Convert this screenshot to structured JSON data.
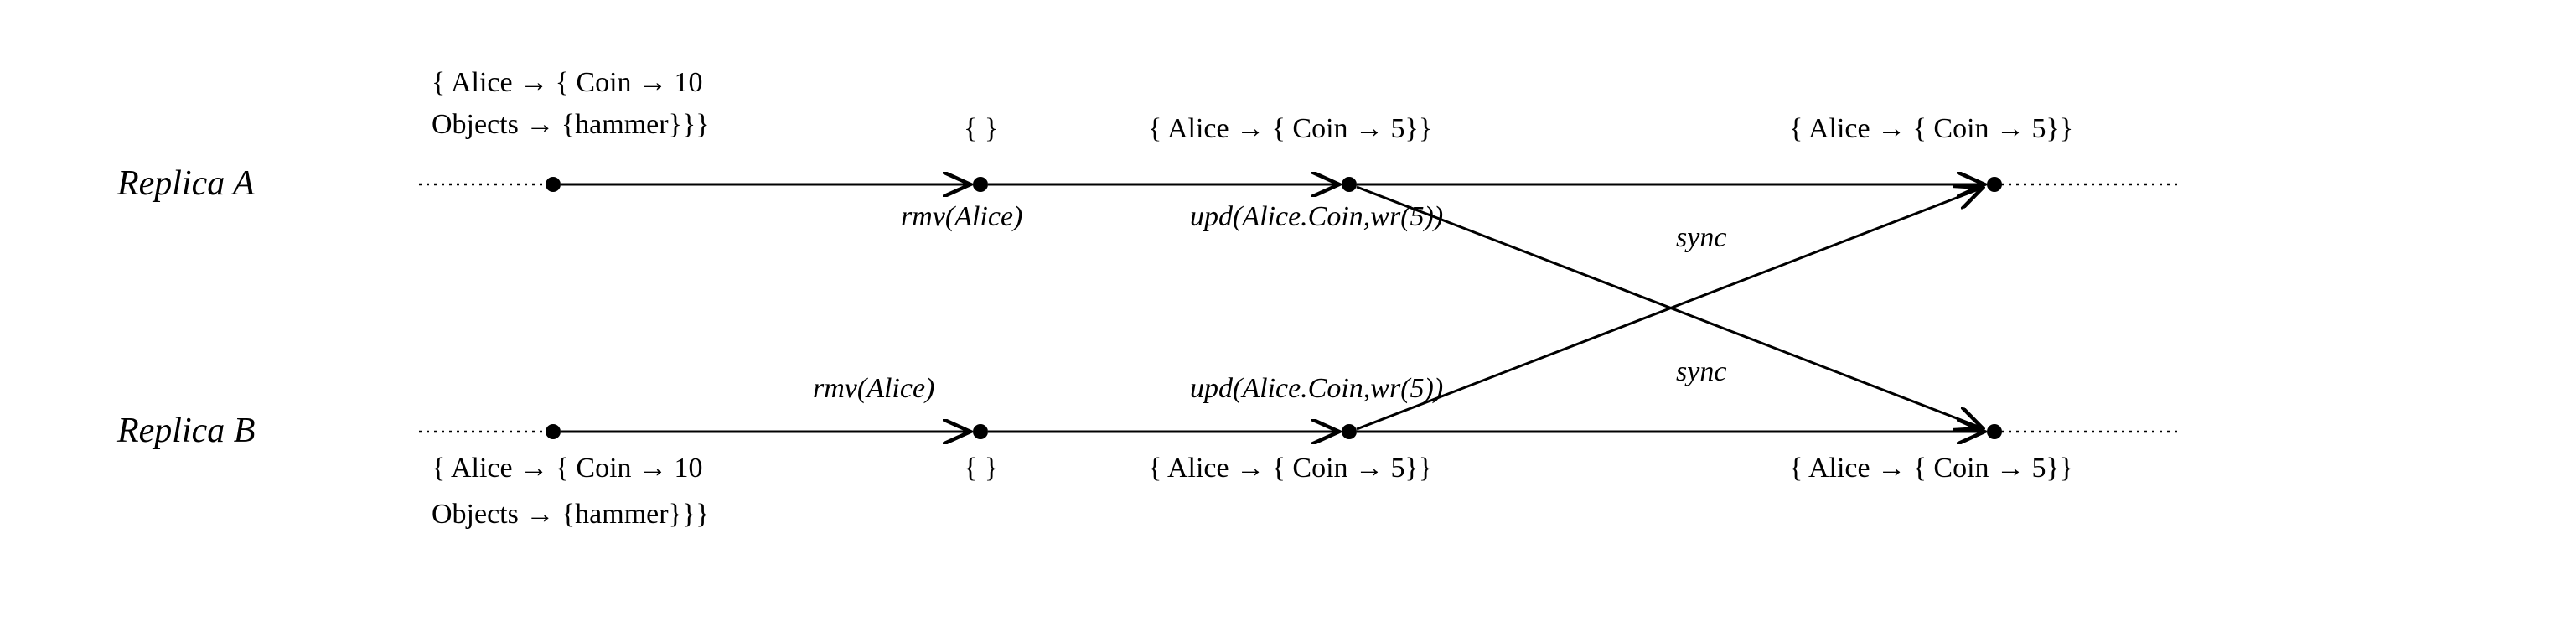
{
  "replicas": {
    "A": {
      "label": "Replica A"
    },
    "B": {
      "label": "Replica B"
    }
  },
  "states": {
    "a0_line1": "{ Alice → { Coin → 10",
    "a0_line2": "Objects → {hammer}}}",
    "a1": "{ }",
    "a2": "{ Alice → { Coin → 5}}",
    "a3": "{ Alice → { Coin → 5}}",
    "b0_line1": "{ Alice → { Coin → 10",
    "b0_line2": "Objects → {hammer}}}",
    "b1": "{ }",
    "b2": "{ Alice → { Coin → 5}}",
    "b3": "{ Alice → { Coin → 5}}"
  },
  "operations": {
    "rmv_a": "rmv(Alice)",
    "upd_a": "upd(Alice.Coin,wr(5))",
    "rmv_b": "rmv(Alice)",
    "upd_b": "upd(Alice.Coin,wr(5))",
    "sync1": "sync",
    "sync2": "sync"
  }
}
